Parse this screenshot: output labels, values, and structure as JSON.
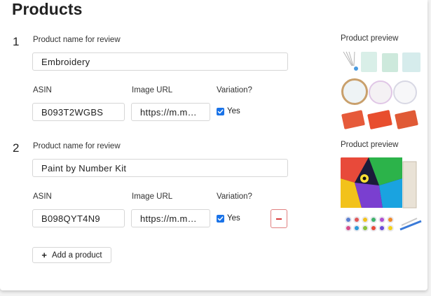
{
  "page_title": "Products",
  "products": [
    {
      "number": "1",
      "name_label": "Product name for review",
      "name_value": "Embroidery",
      "asin_label": "ASIN",
      "asin_value": "B093T2WGBS",
      "image_url_label": "Image URL",
      "image_url_value": "https://m.m…",
      "variation_label": "Variation?",
      "variation_checked": true,
      "variation_text": "Yes",
      "preview_label": "Product preview"
    },
    {
      "number": "2",
      "name_label": "Product name for review",
      "name_value": "Paint by Number Kit",
      "asin_label": "ASIN",
      "asin_value": "B098QYT4N9",
      "image_url_label": "Image URL",
      "image_url_value": "https://m.m…",
      "variation_label": "Variation?",
      "variation_checked": true,
      "variation_text": "Yes",
      "preview_label": "Product preview"
    }
  ],
  "add_product_label": "Add a product",
  "colors": {
    "checkbox": "#1a73e8",
    "remove_border": "#e08080",
    "remove_icon": "#d93a3a"
  }
}
